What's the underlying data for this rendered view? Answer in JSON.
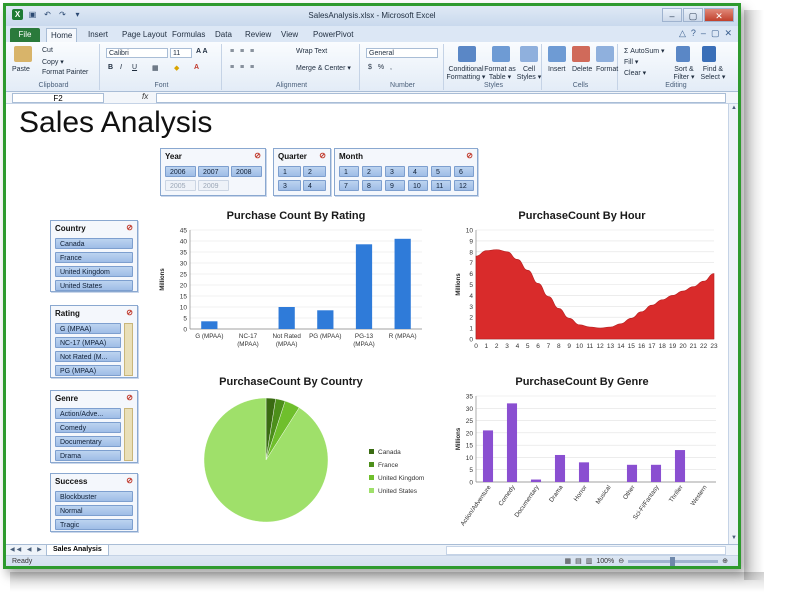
{
  "window": {
    "title": "SalesAnalysis.xlsx - Microsoft Excel",
    "controls": [
      "–",
      "▢",
      "✕"
    ]
  },
  "tabs": [
    "File",
    "Home",
    "Insert",
    "Page Layout",
    "Formulas",
    "Data",
    "Review",
    "View",
    "PowerPivot"
  ],
  "active_tab": "Home",
  "ribbon": {
    "clipboard": {
      "paste": "Paste",
      "cut": "Cut",
      "copy": "Copy ▾",
      "format_painter": "Format Painter",
      "label": "Clipboard"
    },
    "font": {
      "name": "Calibri",
      "size": "11",
      "label": "Font"
    },
    "alignment": {
      "wrap": "Wrap Text",
      "merge": "Merge & Center ▾",
      "label": "Alignment"
    },
    "number": {
      "format": "General",
      "label": "Number"
    },
    "styles": {
      "conditional": "Conditional Formatting ▾",
      "format_table": "Format as Table ▾",
      "cell_styles": "Cell Styles ▾",
      "label": "Styles"
    },
    "cells": {
      "insert": "Insert",
      "delete": "Delete",
      "format": "Format",
      "label": "Cells"
    },
    "editing": {
      "autosum": "AutoSum ▾",
      "fill": "Fill ▾",
      "clear": "Clear ▾",
      "sort": "Sort & Filter ▾",
      "find": "Find & Select ▾",
      "label": "Editing"
    }
  },
  "formula_bar": {
    "name_box": "F2",
    "fx": "fx",
    "value": ""
  },
  "page_title": "Sales Analysis",
  "slicers": {
    "year": {
      "title": "Year",
      "items": [
        {
          "label": "2006",
          "on": true
        },
        {
          "label": "2007",
          "on": true
        },
        {
          "label": "2008",
          "on": true
        },
        {
          "label": "2005",
          "on": false
        },
        {
          "label": "2009",
          "on": false
        }
      ]
    },
    "quarter": {
      "title": "Quarter",
      "items": [
        "1",
        "2",
        "3",
        "4"
      ]
    },
    "month": {
      "title": "Month",
      "items": [
        "1",
        "2",
        "3",
        "4",
        "5",
        "6",
        "7",
        "8",
        "9",
        "10",
        "11",
        "12"
      ]
    },
    "country": {
      "title": "Country",
      "items": [
        "Canada",
        "France",
        "United Kingdom",
        "United States"
      ]
    },
    "rating": {
      "title": "Rating",
      "items": [
        "G (MPAA)",
        "NC-17 (MPAA)",
        "Not Rated (M...",
        "PG (MPAA)"
      ]
    },
    "genre": {
      "title": "Genre",
      "items": [
        "Action/Adve...",
        "Comedy",
        "Documentary",
        "Drama"
      ]
    },
    "success": {
      "title": "Success",
      "items": [
        "Blockbuster",
        "Normal",
        "Tragic"
      ]
    }
  },
  "colors": {
    "bar_blue": "#2f7bd9",
    "area_red": "#d92b2b",
    "bar_purple": "#8a4fd1",
    "pie_light": "#9fe06a",
    "pie_mid": "#6fbf2c",
    "pie_dark": "#4c8f1a",
    "pie_darkest": "#3a6b12"
  },
  "chart_data": [
    {
      "type": "bar",
      "title": "Purchase Count By Rating",
      "ylabel": "Millions",
      "categories": [
        "G (MPAA)",
        "NC-17 (MPAA)",
        "Not Rated (MPAA)",
        "PG (MPAA)",
        "PG-13 (MPAA)",
        "R (MPAA)"
      ],
      "values": [
        3.5,
        0,
        10,
        8.5,
        38.5,
        41
      ],
      "ylim": [
        0,
        45
      ],
      "yticks": [
        0,
        5,
        10,
        15,
        20,
        25,
        30,
        35,
        40,
        45
      ]
    },
    {
      "type": "area",
      "title": "PurchaseCount By Hour",
      "ylabel": "Millions",
      "x": [
        0,
        1,
        2,
        3,
        4,
        5,
        6,
        7,
        8,
        9,
        10,
        11,
        12,
        13,
        14,
        15,
        16,
        17,
        18,
        19,
        20,
        21,
        22,
        23
      ],
      "values": [
        7.6,
        8.1,
        8.2,
        8.0,
        7.3,
        6.3,
        5.1,
        3.9,
        2.8,
        1.9,
        1.3,
        1.1,
        1.0,
        1.1,
        1.4,
        1.9,
        2.5,
        3.1,
        3.6,
        4.0,
        4.4,
        4.8,
        5.3,
        6.0
      ],
      "ylim": [
        0,
        10
      ],
      "yticks": [
        0,
        1,
        2,
        3,
        4,
        5,
        6,
        7,
        8,
        9,
        10
      ]
    },
    {
      "type": "pie",
      "title": "PurchaseCount By Country",
      "categories": [
        "Canada",
        "France",
        "United Kingdom",
        "United States"
      ],
      "values": [
        2.5,
        2.5,
        4.0,
        91.0
      ],
      "legend": "right"
    },
    {
      "type": "bar",
      "title": "PurchaseCount By Genre",
      "ylabel": "Millions",
      "categories": [
        "Action/Adventure",
        "Comedy",
        "Documentary",
        "Drama",
        "Horror",
        "Musical",
        "Other",
        "Sci-Fi/Fantasy",
        "Thriller",
        "Western"
      ],
      "values": [
        21,
        32,
        1,
        11,
        8,
        0,
        7,
        7,
        13,
        0
      ],
      "ylim": [
        0,
        35
      ],
      "yticks": [
        0,
        5,
        10,
        15,
        20,
        25,
        30,
        35
      ]
    }
  ],
  "status": {
    "ready": "Ready",
    "sheet_tab": "Sales Analysis",
    "zoom": "100%",
    "nav": "◀◀ ◀ ▶ ▶▶"
  }
}
